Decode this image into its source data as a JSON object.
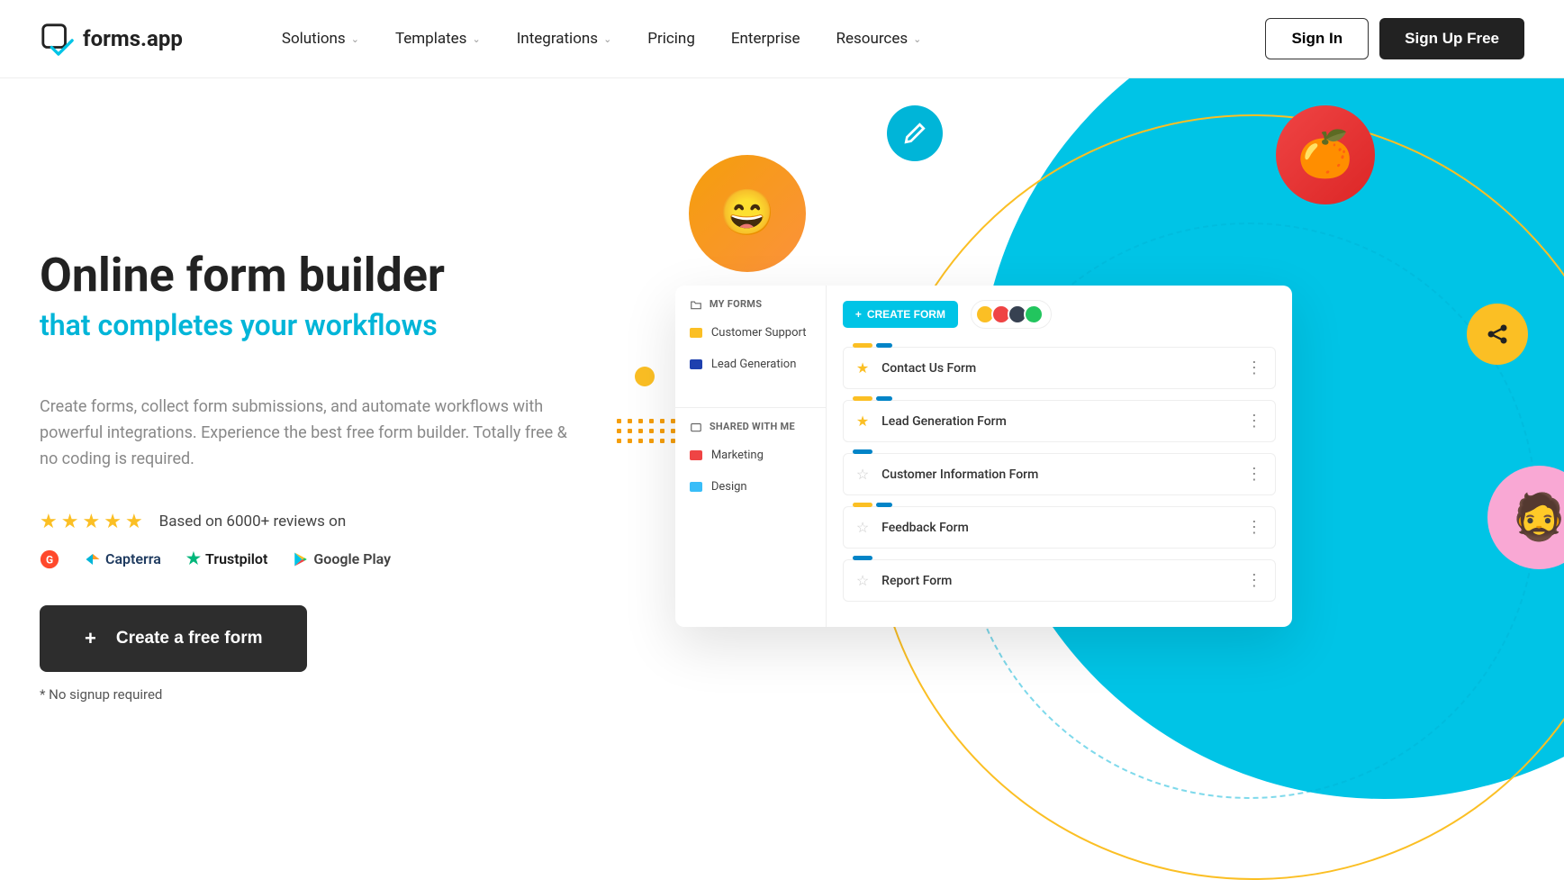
{
  "brand": "forms.app",
  "nav": {
    "solutions": "Solutions",
    "templates": "Templates",
    "integrations": "Integrations",
    "pricing": "Pricing",
    "enterprise": "Enterprise",
    "resources": "Resources"
  },
  "auth": {
    "signin": "Sign In",
    "signup": "Sign Up Free"
  },
  "hero": {
    "title": "Online form builder",
    "subtitle": "that completes your workflows",
    "description": "Create forms, collect form submissions, and automate workflows with powerful integrations. Experience the best free form builder. Totally free & no coding is required.",
    "rating_text": "Based on 6000+ reviews on",
    "cta": "Create a free form",
    "note": "* No signup required"
  },
  "review_logos": {
    "g2": "G2",
    "capterra": "Capterra",
    "trustpilot": "Trustpilot",
    "googleplay": "Google Play"
  },
  "mockup": {
    "my_forms": "MY FORMS",
    "shared": "SHARED WITH ME",
    "folders": {
      "customer_support": "Customer Support",
      "lead_gen": "Lead Generation",
      "marketing": "Marketing",
      "design": "Design"
    },
    "create_form": "CREATE FORM",
    "forms": {
      "contact": "Contact Us Form",
      "lead": "Lead Generation Form",
      "customer_info": "Customer Information Form",
      "feedback": "Feedback Form",
      "report": "Report Form"
    }
  }
}
